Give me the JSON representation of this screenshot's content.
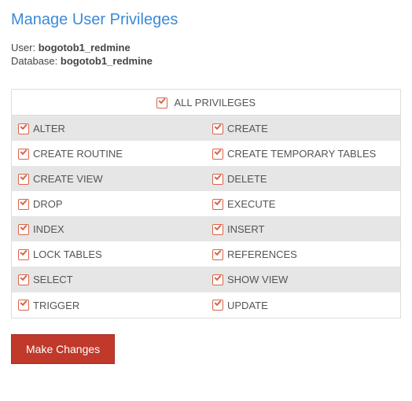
{
  "title": "Manage User Privileges",
  "user_label": "User:",
  "user_value": "bogotob1_redmine",
  "db_label": "Database:",
  "db_value": "bogotob1_redmine",
  "all_privileges": "ALL PRIVILEGES",
  "rows": [
    {
      "left": "ALTER",
      "right": "CREATE"
    },
    {
      "left": "CREATE ROUTINE",
      "right": "CREATE TEMPORARY TABLES"
    },
    {
      "left": "CREATE VIEW",
      "right": "DELETE"
    },
    {
      "left": "DROP",
      "right": "EXECUTE"
    },
    {
      "left": "INDEX",
      "right": "INSERT"
    },
    {
      "left": "LOCK TABLES",
      "right": "REFERENCES"
    },
    {
      "left": "SELECT",
      "right": "SHOW VIEW"
    },
    {
      "left": "TRIGGER",
      "right": "UPDATE"
    }
  ],
  "submit_label": "Make Changes"
}
